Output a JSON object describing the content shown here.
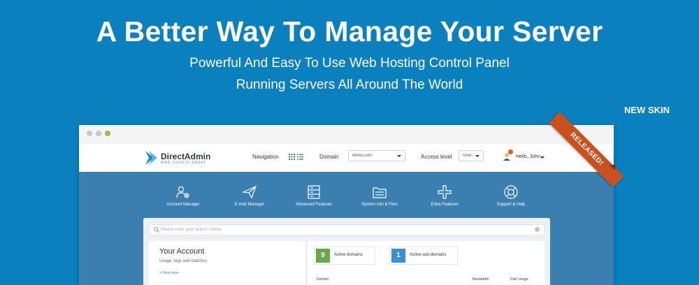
{
  "hero": {
    "title": "A Better Way To Manage Your Server",
    "subtitle_line1": "Powerful And Easy To Use Web Hosting Control Panel",
    "subtitle_line2": "Running Servers All Around The World",
    "new_skin": "NEW SKIN"
  },
  "ribbon": {
    "text": "RELEASED!"
  },
  "topbar": {
    "logo_name": "DirectAdmin",
    "logo_tagline": "web control panel",
    "navigation_label": "Navigation",
    "domain_label": "Domain",
    "domain_value": "demo.com",
    "access_label": "Access level",
    "access_value": "User",
    "greeting": "Hello, John"
  },
  "nav": {
    "items": [
      {
        "label": "Account Manager",
        "icon": "users-gear-icon"
      },
      {
        "label": "E-mail Manager",
        "icon": "paper-plane-icon"
      },
      {
        "label": "Advanced Features",
        "icon": "server-icon"
      },
      {
        "label": "System Info & Files",
        "icon": "folder-icon"
      },
      {
        "label": "Extra Features",
        "icon": "plus-icon"
      },
      {
        "label": "Support & Help",
        "icon": "lifebuoy-icon"
      }
    ]
  },
  "search": {
    "placeholder": "Please enter your search criteria"
  },
  "account": {
    "title": "Your Account",
    "subtitle": "Usage, logs and statistics",
    "more": "+ View more"
  },
  "stats": [
    {
      "value": "9",
      "label": "Active domains",
      "color": "#6aa84f"
    },
    {
      "value": "1",
      "label": "Active sub-domains",
      "color": "#3d8fd4"
    }
  ],
  "table": {
    "headers": [
      "Domain",
      "Bandwidth",
      "Disk Usage"
    ]
  },
  "colors": {
    "background": "#0a80bf",
    "nav": "#3b7fb1",
    "ribbon": "#c8511f"
  }
}
